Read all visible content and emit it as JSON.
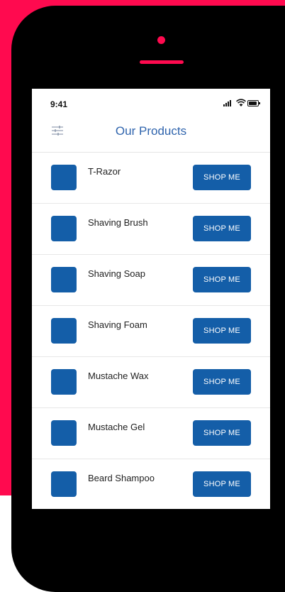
{
  "colors": {
    "accent": "#ff0a4f",
    "primary": "#145ea8",
    "title": "#2f64ad"
  },
  "status_bar": {
    "time": "9:41",
    "icons": [
      "signal-icon",
      "wifi-icon",
      "battery-icon"
    ]
  },
  "header": {
    "title": "Our Products",
    "filter_icon": "filter-sliders-icon"
  },
  "products": [
    {
      "name": "T-Razor",
      "button": "SHOP ME"
    },
    {
      "name": "Shaving Brush",
      "button": "SHOP ME"
    },
    {
      "name": "Shaving Soap",
      "button": "SHOP ME"
    },
    {
      "name": "Shaving Foam",
      "button": "SHOP ME"
    },
    {
      "name": "Mustache Wax",
      "button": "SHOP ME"
    },
    {
      "name": "Mustache Gel",
      "button": "SHOP ME"
    },
    {
      "name": "Beard Shampoo",
      "button": "SHOP ME"
    }
  ]
}
